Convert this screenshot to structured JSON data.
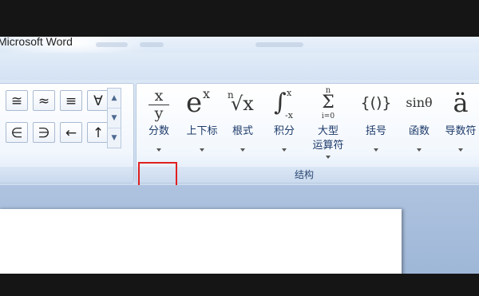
{
  "app": {
    "title": "Microsoft Word"
  },
  "symbols": {
    "row1": [
      "≅",
      "≈",
      "≡",
      "∀"
    ],
    "row2": [
      "∈",
      "∋",
      "←",
      "↑"
    ]
  },
  "structures": {
    "group_label": "结构",
    "items": [
      {
        "id": "fraction",
        "label": "分数"
      },
      {
        "id": "script",
        "label": "上下标"
      },
      {
        "id": "radical",
        "label": "根式"
      },
      {
        "id": "integral",
        "label": "积分"
      },
      {
        "id": "large-operator",
        "label": "大型",
        "label2": "运算符"
      },
      {
        "id": "bracket",
        "label": "括号"
      },
      {
        "id": "function",
        "label": "函数"
      },
      {
        "id": "accent",
        "label": "导数符"
      }
    ],
    "glyphs": {
      "frac_num": "x",
      "frac_den": "y",
      "exp_base": "e",
      "exp_sup": "x",
      "root_index": "n",
      "root_sign": "√x",
      "int_sign": "∫",
      "int_upper": "x",
      "int_lower": "-x",
      "sum_upper": "n",
      "sum_sign": "Σ",
      "sum_lower": "i=0",
      "bracket": "{()}",
      "func": "sinθ",
      "accent": "ä"
    }
  },
  "colors": {
    "highlight": "#e02020",
    "ribbon": "#dbe7f5"
  }
}
